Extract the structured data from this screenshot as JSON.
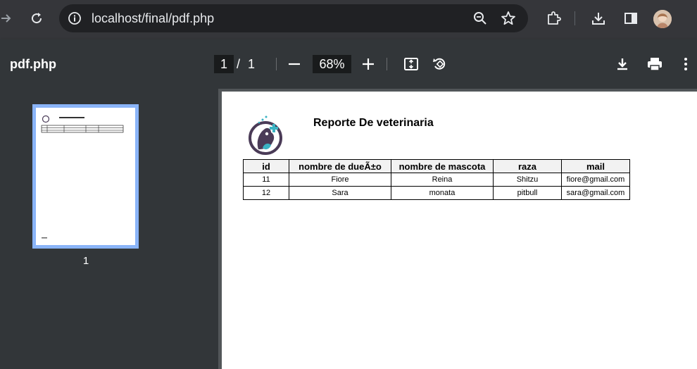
{
  "browser": {
    "url": "localhost/final/pdf.php"
  },
  "pdf_toolbar": {
    "title": "pdf.php",
    "current_page": "1",
    "page_separator": "/",
    "total_pages": "1",
    "zoom": "68%"
  },
  "sidebar": {
    "thumbnail_label": "1"
  },
  "document": {
    "title": "Reporte De veterinaria",
    "table": {
      "headers": [
        "id",
        "nombre de dueÃ±o",
        "nombre de mascota",
        "raza",
        "mail"
      ],
      "rows": [
        [
          "11",
          "Fiore",
          "Reina",
          "Shitzu",
          "fiore@gmail.com"
        ],
        [
          "12",
          "Sara",
          "monata",
          "pitbull",
          "sara@gmail.com"
        ]
      ]
    }
  },
  "colors": {
    "browser_bg": "#35363a",
    "omnibox_bg": "#202124",
    "pdf_toolbar_bg": "#323639",
    "viewer_bg": "#525659",
    "thumbnail_highlight": "#8ab4f8",
    "logo_accent": "#3bb3c3",
    "logo_dark": "#4a3b57"
  }
}
